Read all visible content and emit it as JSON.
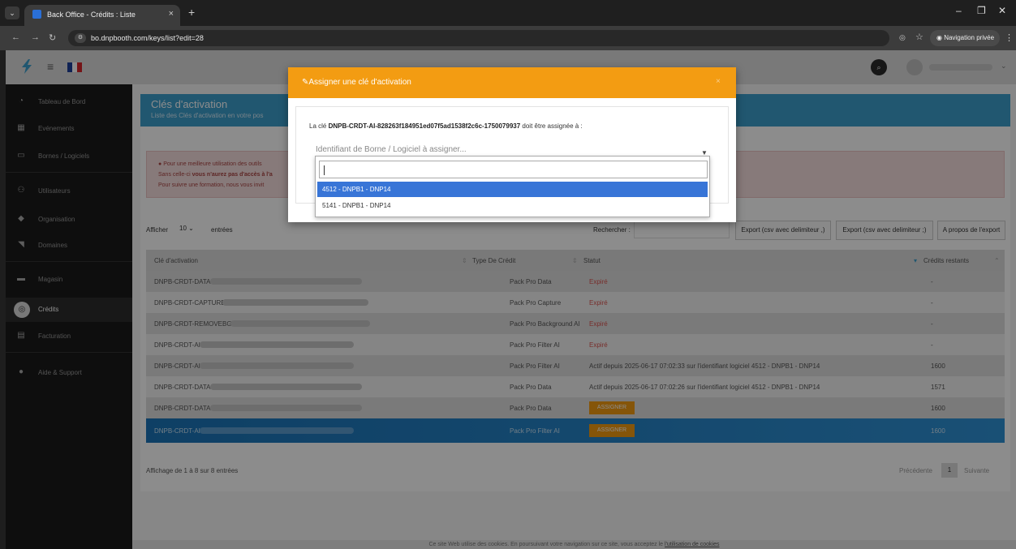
{
  "browser": {
    "tab_title": "Back Office - Crédits : Liste",
    "url": "bo.dnpbooth.com/keys/list?edit=28",
    "private_label": "Navigation privée"
  },
  "sidebar": {
    "items": [
      {
        "label": "Tableau de Bord",
        "icon": "dashboard-icon"
      },
      {
        "label": "Evénements",
        "icon": "calendar-icon"
      },
      {
        "label": "Bornes / Logiciels",
        "icon": "monitor-icon"
      },
      {
        "label": "Utilisateurs",
        "icon": "users-icon"
      },
      {
        "label": "Organisation",
        "icon": "tag-icon"
      },
      {
        "label": "Domaines",
        "icon": "rss-icon"
      },
      {
        "label": "Magasin",
        "icon": "store-icon"
      },
      {
        "label": "Crédits",
        "icon": "coins-icon"
      },
      {
        "label": "Facturation",
        "icon": "invoice-icon"
      },
      {
        "label": "Aide & Support",
        "icon": "info-icon"
      }
    ]
  },
  "header": {
    "title": "Clés d'activation",
    "subtitle": "Liste des Clés d'activation en votre pos"
  },
  "alert": {
    "line1": "Pour une meilleure utilisation des outils",
    "line2_pre": "Sans celle-ci ",
    "line2_bold": "vous n'aurez pas d'accès à l'a",
    "line3": "Pour suivre une formation, nous vous invit"
  },
  "controls": {
    "show_label": "Afficher",
    "page_length": "10",
    "entries_label": "entrées",
    "search_label": "Rechercher :",
    "export_buttons": [
      "Export (csv avec delimiteur ,)",
      "Export (csv avec delimiteur ;)",
      "A propos de l'export"
    ]
  },
  "table": {
    "columns": [
      "Clé d'activation",
      "Type De Crédit",
      "Statut",
      "Crédits restants"
    ],
    "rows": [
      {
        "key": "DNPB-CRDT-DATA-",
        "type": "Pack Pro Data",
        "status": "Expiré",
        "status_kind": "expired",
        "credits": "-"
      },
      {
        "key": "DNPB-CRDT-CAPTURE-",
        "type": "Pack Pro Capture",
        "status": "Expiré",
        "status_kind": "expired",
        "credits": "-"
      },
      {
        "key": "DNPB-CRDT-REMOVEBG-",
        "type": "Pack Pro Background AI",
        "status": "Expiré",
        "status_kind": "expired",
        "credits": "-"
      },
      {
        "key": "DNPB-CRDT-AI-",
        "type": "Pack Pro Filter AI",
        "status": "Expiré",
        "status_kind": "expired",
        "credits": "-"
      },
      {
        "key": "DNPB-CRDT-AI-",
        "type": "Pack Pro Filter AI",
        "status": "Actif depuis 2025-06-17 07:02:33 sur l'identifiant logiciel 4512 - DNPB1 - DNP14",
        "status_kind": "active",
        "credits": "1600"
      },
      {
        "key": "DNPB-CRDT-DATA-",
        "type": "Pack Pro Data",
        "status": "Actif depuis 2025-06-17 07:02:26 sur l'identifiant logiciel 4512 - DNPB1 - DNP14",
        "status_kind": "active",
        "credits": "1571"
      },
      {
        "key": "DNPB-CRDT-DATA-",
        "type": "Pack Pro Data",
        "status": "ASSIGNER",
        "status_kind": "button",
        "credits": "1600"
      },
      {
        "key": "DNPB-CRDT-AI-",
        "type": "Pack Pro Filter AI",
        "status": "ASSIGNER",
        "status_kind": "button",
        "credits": "1600",
        "selected": true
      }
    ]
  },
  "footer": {
    "info": "Affichage de 1 à 8 sur 8 entrées",
    "prev": "Précédente",
    "page": "1",
    "next": "Suivante"
  },
  "cookie": {
    "text": "Ce site Web utilise des cookies. En poursuivant votre navigation sur ce site, vous acceptez le ",
    "link": "l'utilisation de cookies"
  },
  "modal": {
    "title": "Assigner une clé d'activation",
    "close": "×",
    "text_pre": "La clé ",
    "key": "DNPB-CRDT-AI-828263f184951ed07f5ad1538f2c6c-1750079937",
    "text_post": " doit être assignée à :",
    "select_placeholder": "Identifiant de Borne / Logiciel à assigner...",
    "options": [
      "4512 - DNPB1 - DNP14",
      "5141 - DNPB1 - DNP14"
    ]
  },
  "colors": {
    "accent": "#f39c12",
    "header": "#3d9fcd",
    "selected_row": "#1b74b8",
    "expired": "#d9534f"
  }
}
